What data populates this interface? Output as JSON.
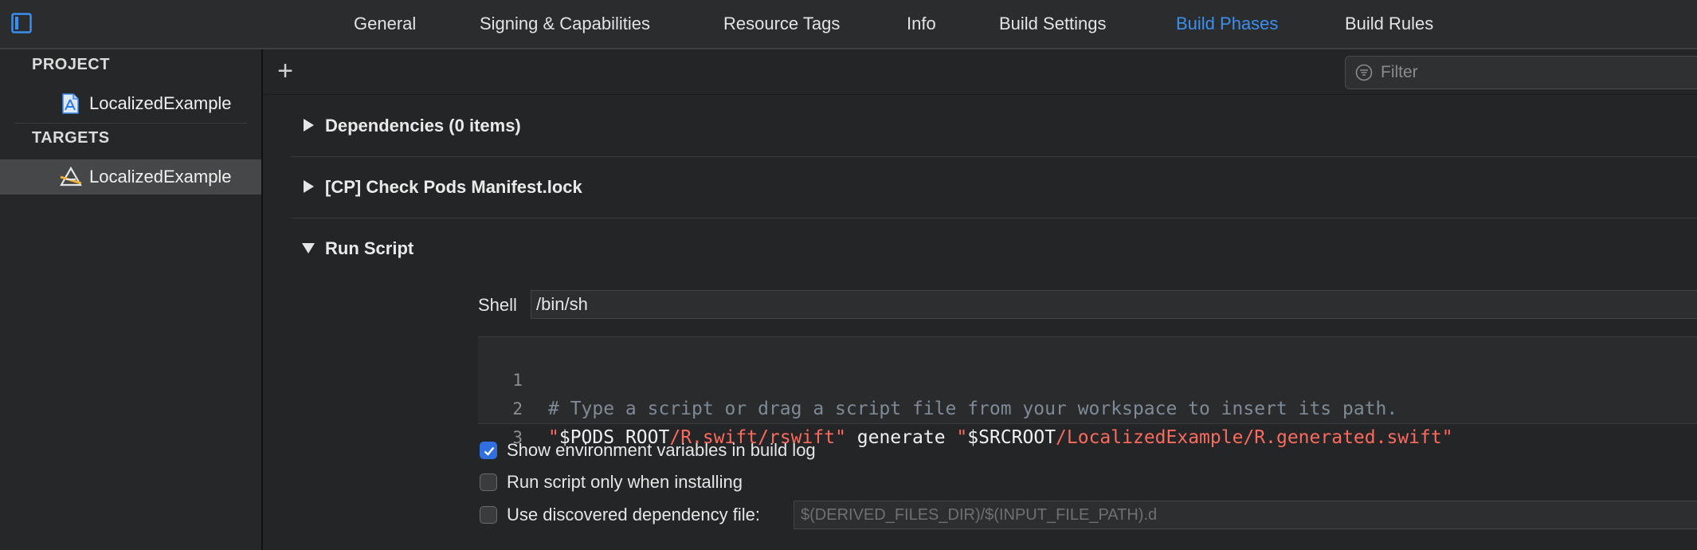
{
  "tabs": [
    {
      "label": "General",
      "active": false
    },
    {
      "label": "Signing & Capabilities",
      "active": false
    },
    {
      "label": "Resource Tags",
      "active": false
    },
    {
      "label": "Info",
      "active": false
    },
    {
      "label": "Build Settings",
      "active": false
    },
    {
      "label": "Build Phases",
      "active": true
    },
    {
      "label": "Build Rules",
      "active": false
    }
  ],
  "sidebar": {
    "project_header": "PROJECT",
    "project_item": "LocalizedExample",
    "targets_header": "TARGETS",
    "target_item": "LocalizedExample"
  },
  "toolbar": {
    "add_label": "+",
    "filter_placeholder": "Filter"
  },
  "phases": [
    {
      "title": "Dependencies (0 items)",
      "expanded": false
    },
    {
      "title": "[CP] Check Pods Manifest.lock",
      "expanded": false
    },
    {
      "title": "Run Script",
      "expanded": true
    }
  ],
  "run_script": {
    "shell_label": "Shell",
    "shell_value": "/bin/sh",
    "lines": [
      {
        "num": "1",
        "comment": "# Type a script or drag a script file from your workspace to insert its path."
      },
      {
        "num": "2",
        "q1": "\"",
        "var1": "$PODS_ROOT",
        "path1": "/R.swift/rswift",
        "q2": "\"",
        "mid": " generate ",
        "q3": "\"",
        "var2": "$SRCROOT",
        "path2": "/LocalizedExample/R.generated.swift",
        "q4": "\""
      },
      {
        "num": "3"
      }
    ],
    "options": [
      {
        "label": "Show environment variables in build log",
        "checked": true
      },
      {
        "label": "Run script only when installing",
        "checked": false
      },
      {
        "label": "Use discovered dependency file:",
        "checked": false
      }
    ],
    "dependency_file_placeholder": "$(DERIVED_FILES_DIR)/$(INPUT_FILE_PATH).d"
  },
  "colors": {
    "accent": "#3b8ff0",
    "string": "#fc6a5d",
    "comment": "#7e8a96",
    "background": "#242526"
  }
}
